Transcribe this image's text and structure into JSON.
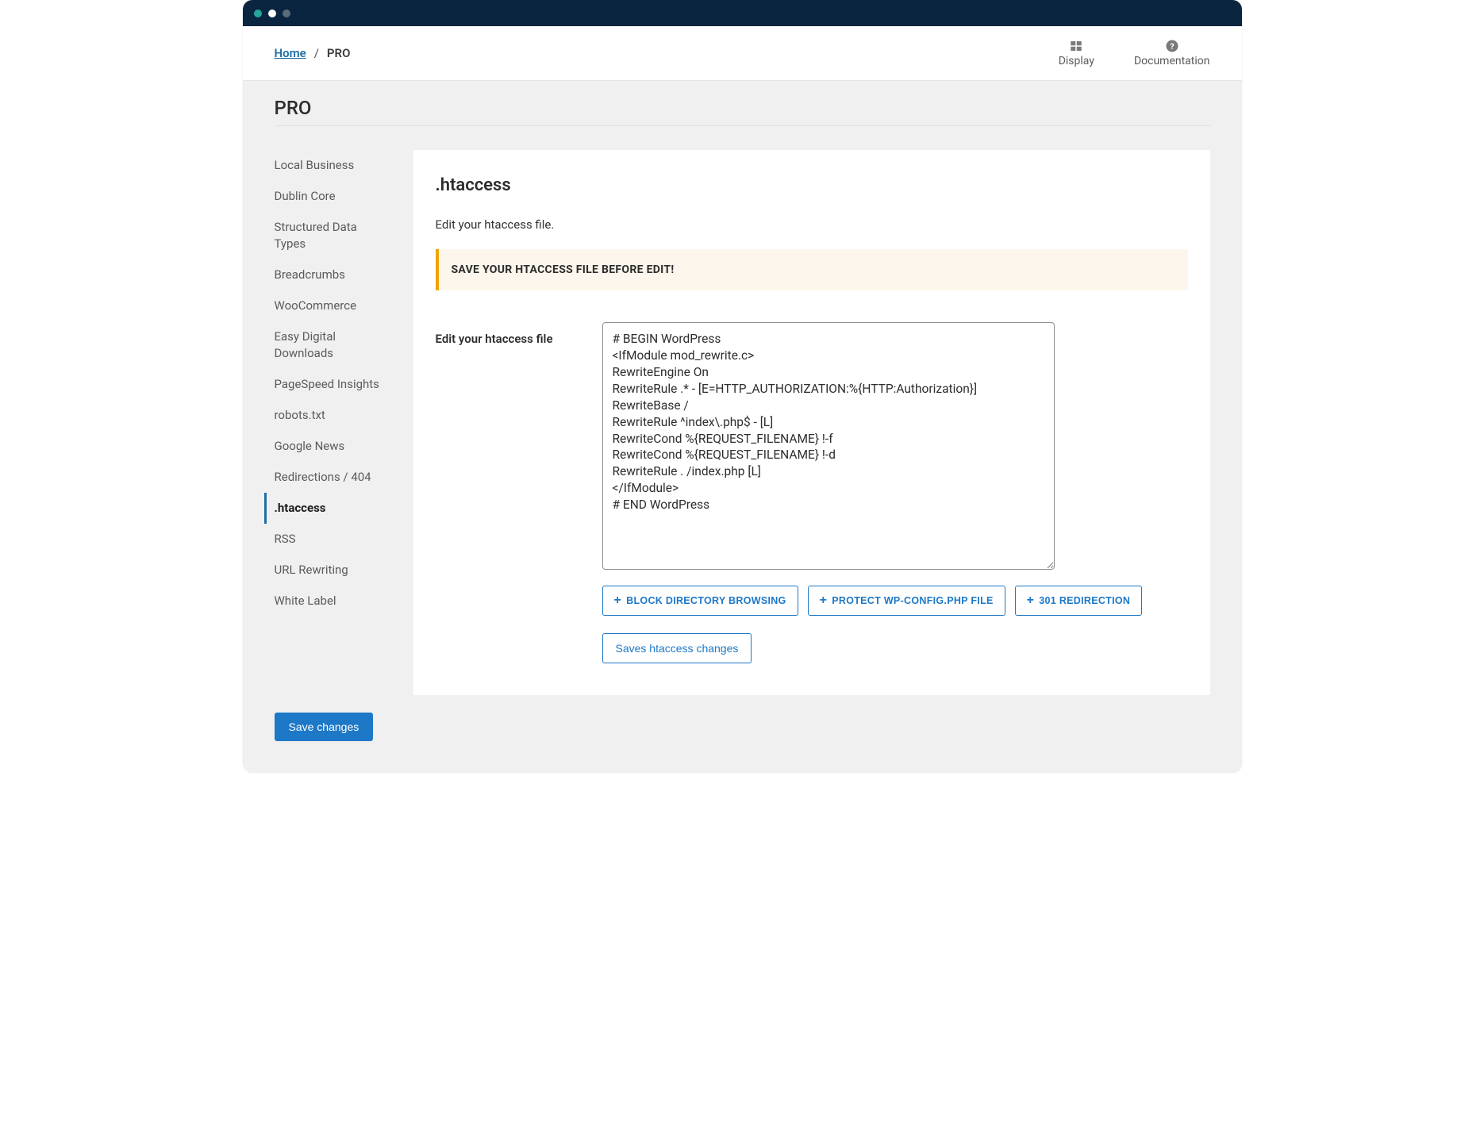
{
  "breadcrumb": {
    "home": "Home",
    "current": "PRO"
  },
  "toplinks": {
    "display": "Display",
    "documentation": "Documentation"
  },
  "page_title": "PRO",
  "sidebar": {
    "items": [
      {
        "label": "Local Business"
      },
      {
        "label": "Dublin Core"
      },
      {
        "label": "Structured Data Types"
      },
      {
        "label": "Breadcrumbs"
      },
      {
        "label": "WooCommerce"
      },
      {
        "label": "Easy Digital Downloads"
      },
      {
        "label": "PageSpeed Insights"
      },
      {
        "label": "robots.txt"
      },
      {
        "label": "Google News"
      },
      {
        "label": "Redirections / 404"
      },
      {
        "label": ".htaccess",
        "active": true
      },
      {
        "label": "RSS"
      },
      {
        "label": "URL Rewriting"
      },
      {
        "label": "White Label"
      }
    ]
  },
  "panel": {
    "heading": ".htaccess",
    "description": "Edit your htaccess file.",
    "alert": "SAVE YOUR HTACCESS FILE BEFORE EDIT!",
    "form_label": "Edit your htaccess file",
    "textarea_value": "# BEGIN WordPress\n<IfModule mod_rewrite.c>\nRewriteEngine On\nRewriteRule .* - [E=HTTP_AUTHORIZATION:%{HTTP:Authorization}]\nRewriteBase /\nRewriteRule ^index\\.php$ - [L]\nRewriteCond %{REQUEST_FILENAME} !-f\nRewriteCond %{REQUEST_FILENAME} !-d\nRewriteRule . /index.php [L]\n</IfModule>\n# END WordPress",
    "actions": {
      "block_dir": "BLOCK DIRECTORY BROWSING",
      "protect": "PROTECT WP-CONFIG.PHP FILE",
      "redir301": "301 REDIRECTION",
      "save_htaccess": "Saves htaccess changes"
    }
  },
  "footer": {
    "save": "Save changes"
  }
}
